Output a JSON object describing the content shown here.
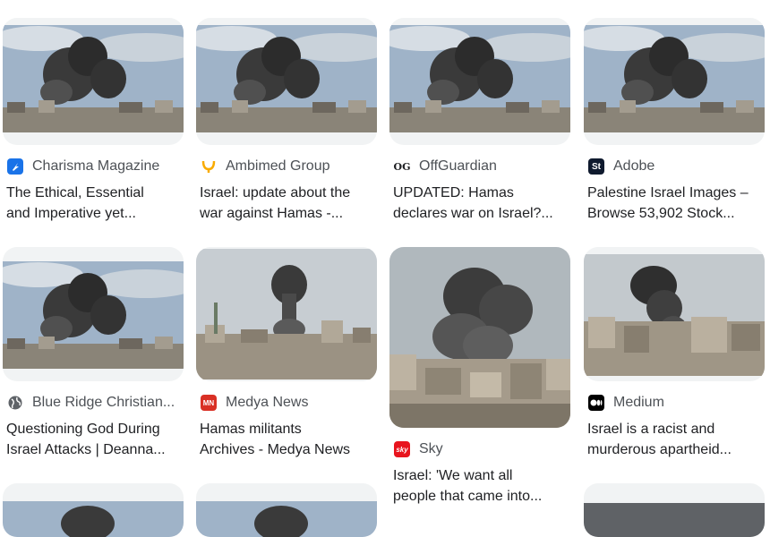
{
  "results": [
    {
      "source": "Charisma Magazine",
      "title_line1": "The Ethical, Essential",
      "title_line2": "and Imperative yet...",
      "icon": "charisma-icon"
    },
    {
      "source": "Ambimed Group",
      "title_line1": "Israel: update about the",
      "title_line2": "war against Hamas -...",
      "icon": "ambimed-icon"
    },
    {
      "source": "OffGuardian",
      "title_line1": "UPDATED: Hamas",
      "title_line2": "declares war on Israel?...",
      "icon": "offguardian-icon"
    },
    {
      "source": "Adobe",
      "title_line1": "Palestine Israel Images –",
      "title_line2": "Browse 53,902 Stock...",
      "icon": "adobe-stock-icon"
    },
    {
      "source": "Blue Ridge Christian...",
      "title_line1": "Questioning God During",
      "title_line2": "Israel Attacks | Deanna...",
      "icon": "globe-icon"
    },
    {
      "source": "Medya News",
      "title_line1": "Hamas militants",
      "title_line2": "Archives - Medya News",
      "icon": "medya-news-icon"
    },
    {
      "source": "Sky",
      "title_line1": "Israel: 'We want all",
      "title_line2": "people that came into...",
      "icon": "sky-news-icon"
    },
    {
      "source": "Medium",
      "title_line1": "Israel is a racist and",
      "title_line2": "murderous apartheid...",
      "icon": "medium-icon"
    }
  ],
  "icon_labels": {
    "adobe": "St",
    "medya": "MN",
    "sky": "sky",
    "offguardian": "OG"
  },
  "colors": {
    "charisma": "#1a73e8",
    "ambimed": "#f9ab00",
    "adobe": "#0f1a2e",
    "medya": "#d93025",
    "sky": "#e8141e",
    "medium": "#000000",
    "globe": "#5f6368"
  }
}
